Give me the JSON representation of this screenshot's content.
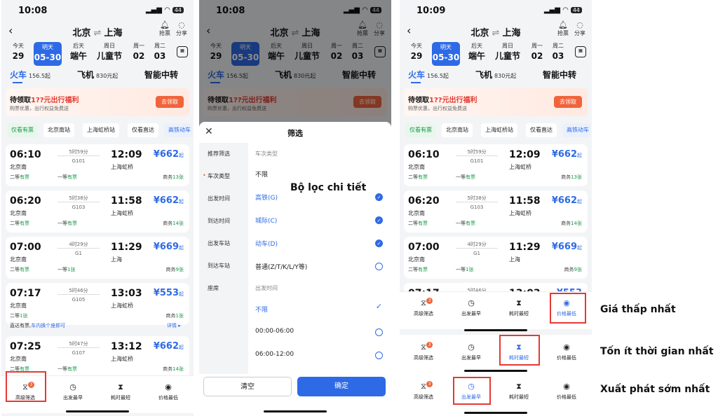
{
  "status": {
    "time1": "10:08",
    "time2": "10:08",
    "time3": "10:09",
    "battery": "44"
  },
  "header": {
    "from": "北京",
    "swap": "⇌",
    "to": "上海",
    "grab": "抢票",
    "share": "分享"
  },
  "dates": [
    {
      "w": "今天",
      "d": "29"
    },
    {
      "w": "明天",
      "d": "05-30"
    },
    {
      "w": "后天",
      "d": "端午"
    },
    {
      "w": "周日",
      "d": "儿童节"
    },
    {
      "w": "周一",
      "d": "02"
    },
    {
      "w": "周二",
      "d": "03"
    }
  ],
  "modes": {
    "train": "火车",
    "train_price": "156.5起",
    "plane": "飞机",
    "plane_price": "830元起",
    "smart": "智能中转"
  },
  "promo": {
    "title_a": "待领取",
    "title_b": "1??元出行福利",
    "sub": "购票优惠，出行权益免费送",
    "btn": "去领取"
  },
  "chips": [
    "仅看有票",
    "北京南站",
    "上海虹桥站",
    "仅看直达",
    "高铁动车"
  ],
  "trains": [
    {
      "dep": "06:10",
      "arr": "12:09",
      "dur": "5时59分",
      "no": "G101",
      "ds": "北京南",
      "as": "上海虹桥",
      "price": "662",
      "r1a": "二等",
      "r1b": "有票",
      "r2a": "一等",
      "r2b": "有票",
      "r3a": "商务",
      "r3b": "13张"
    },
    {
      "dep": "06:20",
      "arr": "11:58",
      "dur": "5时38分",
      "no": "G103",
      "ds": "北京南",
      "as": "上海虹桥",
      "price": "662",
      "r1a": "二等",
      "r1b": "有票",
      "r2a": "一等",
      "r2b": "有票",
      "r3a": "商务",
      "r3b": "14张"
    },
    {
      "dep": "07:00",
      "arr": "11:29",
      "dur": "4时29分",
      "no": "G1",
      "ds": "北京南",
      "as": "上海",
      "price": "669",
      "r1a": "二等",
      "r1b": "有票",
      "r2a": "一等",
      "r2b": "1张",
      "r3a": "商务",
      "r3b": "9张"
    },
    {
      "dep": "07:17",
      "arr": "13:03",
      "dur": "5时46分",
      "no": "G105",
      "ds": "北京南",
      "as": "上海虹桥",
      "price": "553",
      "r1a": "二等",
      "r1b": "1张",
      "r2a": "",
      "r2b": "",
      "r3a": "商务",
      "r3b": "1张"
    },
    {
      "dep": "07:25",
      "arr": "13:12",
      "dur": "5时47分",
      "no": "G107",
      "ds": "北京南",
      "as": "上海虹桥",
      "price": "662",
      "r1a": "二等",
      "r1b": "有票",
      "r2a": "一等",
      "r2b": "有票",
      "r3a": "商务",
      "r3b": "14张"
    }
  ],
  "price_suffix": "起",
  "yen": "¥",
  "direct_note": {
    "a": "直达有票,",
    "b": "车内换个座即可",
    "c": "详情 ▸"
  },
  "bottom": {
    "filter": "高级筛选",
    "earliest": "出发最早",
    "shortest": "耗时最短",
    "cheapest": "价格最低",
    "badge": "3"
  },
  "filter_sheet": {
    "title": "筛选",
    "side": [
      "推荐筛选",
      "车次类型",
      "出发时间",
      "到达时间",
      "出发车站",
      "到达车站",
      "座席"
    ],
    "sec1": "车次类型",
    "opts1": [
      "不限",
      "高铁(G)",
      "城际(C)",
      "动车(D)",
      "普通(Z/T/K/L/Y等)"
    ],
    "sec2": "出发时间",
    "opts2": [
      "不限",
      "00:00-06:00",
      "06:00-12:00"
    ],
    "clear": "清空",
    "ok": "确定"
  },
  "annotations": {
    "detail": "Bộ lọc chi tiết",
    "cheapest": "Giá thấp nhất",
    "shortest": "Tốn ít thời gian nhất",
    "earliest": "Xuất phát sớm nhất"
  }
}
